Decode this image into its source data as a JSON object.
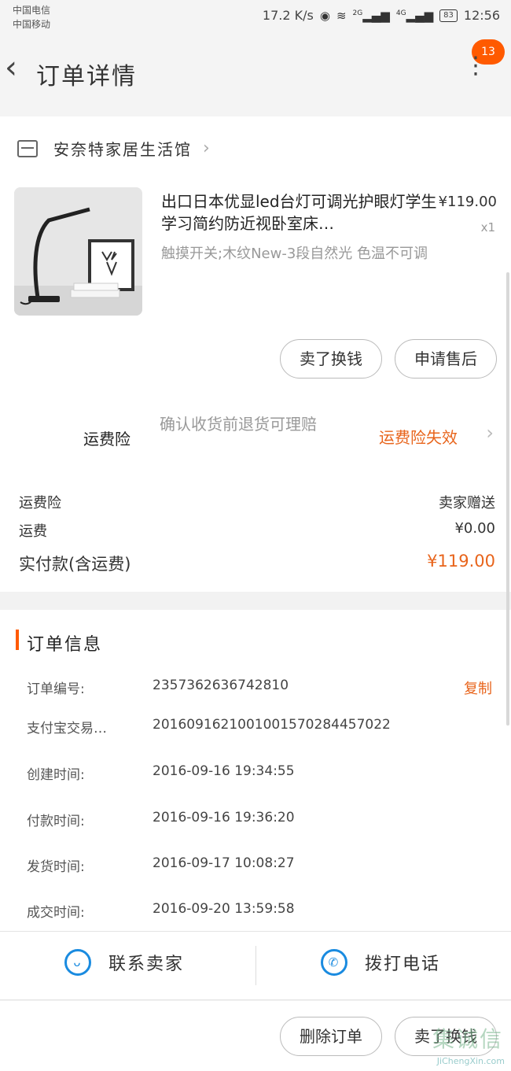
{
  "status": {
    "carrier1": "中国电信",
    "carrier2": "中国移动",
    "speed": "17.2 K/s",
    "net1": "2G",
    "net2": "4G",
    "battery": "83",
    "time": "12:56"
  },
  "header": {
    "title": "订单详情",
    "badge": "13"
  },
  "shop": {
    "name": "安奈特家居生活馆"
  },
  "product": {
    "name": "出口日本优显led台灯可调光护眼灯学生学习简约防近视卧室床…",
    "price": "¥119.00",
    "qty": "x1",
    "sku": "触摸开关;木纹New-3段自然光 色温不可调"
  },
  "item_actions": {
    "exchange": "卖了换钱",
    "after_sale": "申请售后"
  },
  "insurance": {
    "label": "运费险",
    "desc": "确认收货前退货可理赔",
    "status": "运费险失效"
  },
  "fees": [
    {
      "label": "运费险",
      "value": "卖家赠送"
    },
    {
      "label": "运费",
      "value": "¥0.00"
    },
    {
      "label": "实付款(含运费)",
      "value": "¥119.00"
    }
  ],
  "order_info": {
    "title": "订单信息",
    "copy": "复制",
    "rows": [
      {
        "label": "订单编号:",
        "value": "2357362636742810"
      },
      {
        "label": "支付宝交易…",
        "value": "2016091621001001570284457022"
      },
      {
        "label": "创建时间:",
        "value": "2016-09-16 19:34:55"
      },
      {
        "label": "付款时间:",
        "value": "2016-09-16 19:36:20"
      },
      {
        "label": "发货时间:",
        "value": "2016-09-17 10:08:27"
      },
      {
        "label": "成交时间:",
        "value": "2016-09-20 13:59:58"
      }
    ]
  },
  "contact": {
    "seller": "联系卖家",
    "call": "拨打电话"
  },
  "bottom_actions": {
    "delete": "删除订单",
    "exchange": "卖了换钱"
  },
  "watermark": {
    "brand": "集诚信",
    "url": "JiChengXin.com"
  }
}
